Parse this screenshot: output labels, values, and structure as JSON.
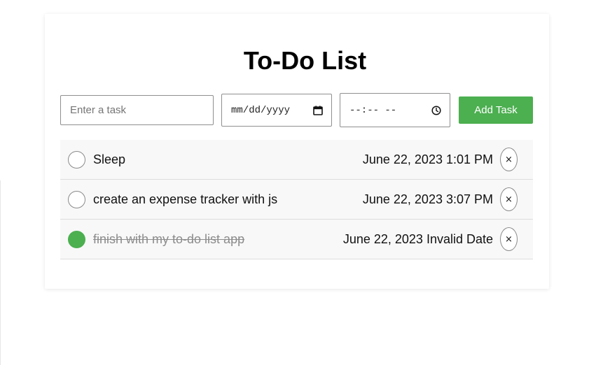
{
  "app": {
    "title": "To-Do List"
  },
  "form": {
    "task_placeholder": "Enter a task",
    "task_value": "",
    "date_placeholder": "mm/dd/yyyy",
    "time_placeholder": "--:-- --",
    "add_label": "Add Task",
    "date_icon": "calendar-icon",
    "time_icon": "clock-icon"
  },
  "colors": {
    "accent": "#4caf50",
    "row_background": "#f8f8f8",
    "completed_text": "#8c8c8c"
  },
  "tasks": [
    {
      "text": "Sleep",
      "datetime": "June 22, 2023 1:01 PM",
      "completed": false,
      "delete_label": "×"
    },
    {
      "text": "create an expense tracker with js",
      "datetime": "June 22, 2023 3:07 PM",
      "completed": false,
      "delete_label": "×"
    },
    {
      "text": "finish with my to-do list app",
      "datetime": "June 22, 2023 Invalid Date",
      "completed": true,
      "delete_label": "×"
    }
  ]
}
